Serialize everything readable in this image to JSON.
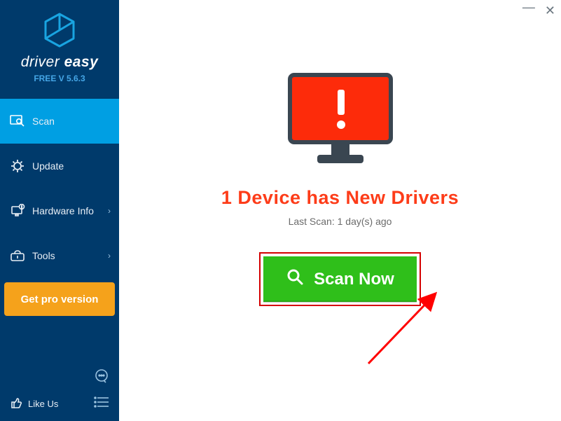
{
  "brand": {
    "name_light": "driver ",
    "name_bold": "easy",
    "version": "FREE V 5.6.3"
  },
  "sidebar": {
    "items": [
      {
        "label": "Scan"
      },
      {
        "label": "Update"
      },
      {
        "label": "Hardware Info"
      },
      {
        "label": "Tools"
      }
    ],
    "get_pro": "Get pro version",
    "like_us": "Like Us"
  },
  "main": {
    "headline": "1 Device has New Drivers",
    "last_scan": "Last Scan: 1 day(s) ago",
    "scan_button": "Scan Now"
  },
  "window": {
    "minimize": "—",
    "close": "✕"
  }
}
